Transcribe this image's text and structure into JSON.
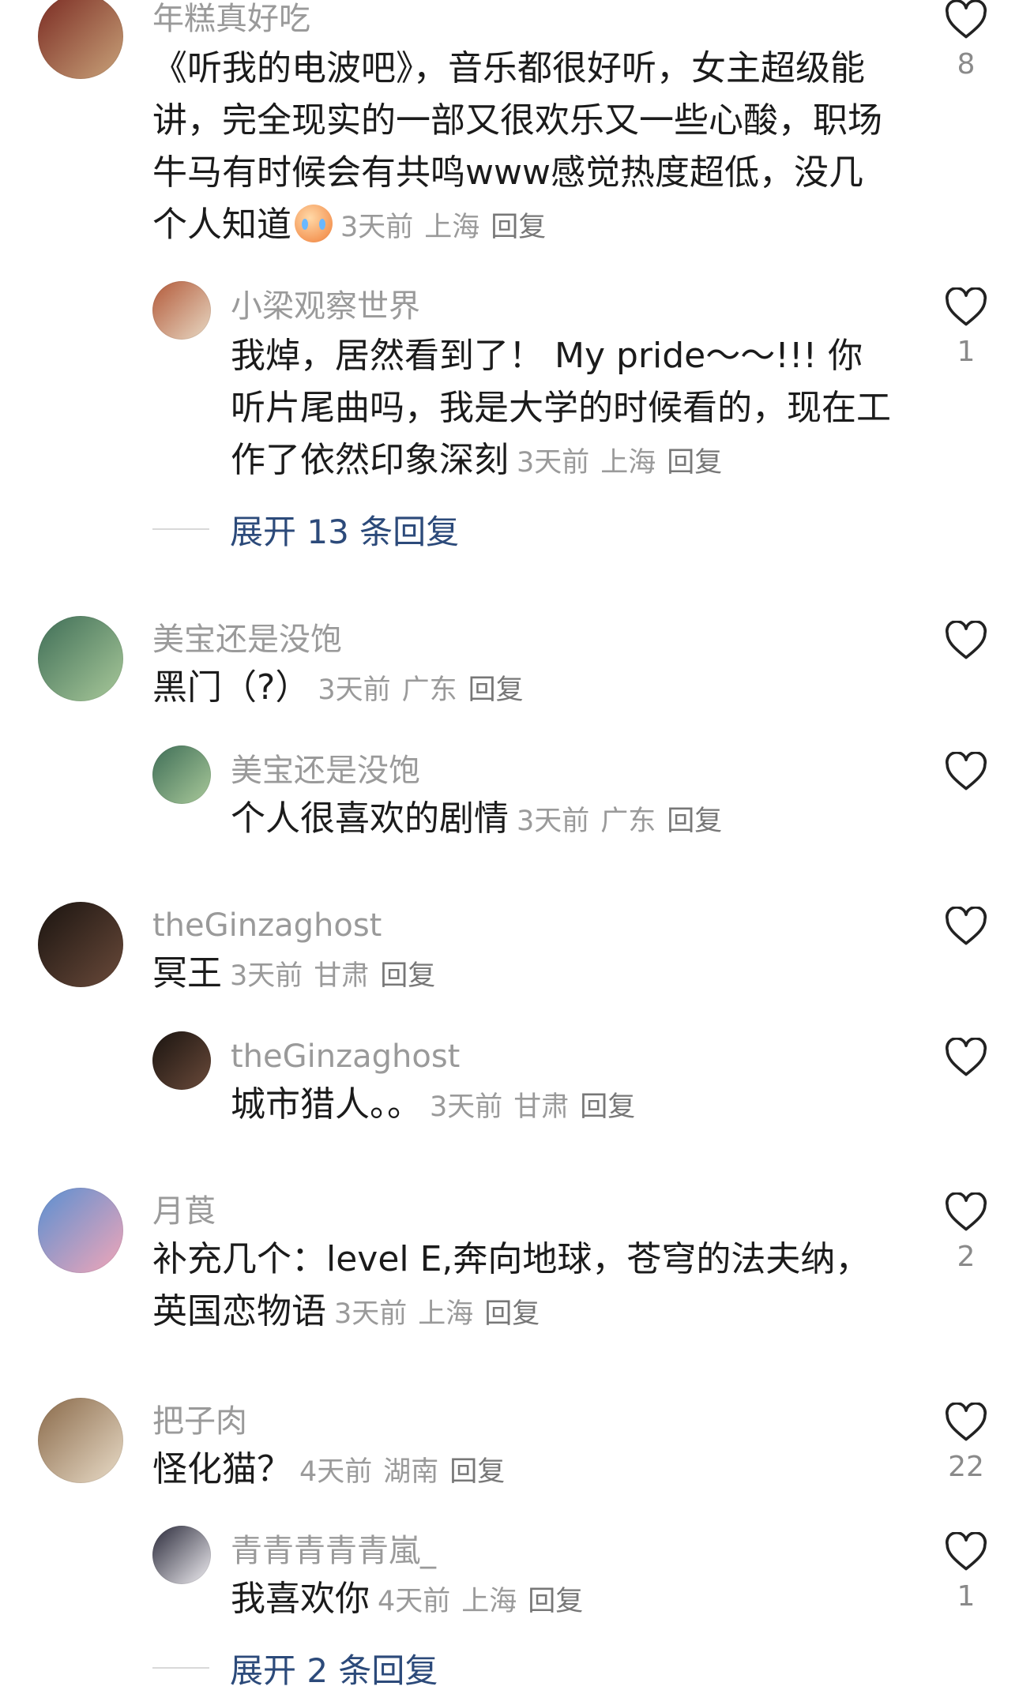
{
  "comments": [
    {
      "user": "年糕真好吃",
      "text": "《听我的电波吧》，音乐都很好听，女主超级能讲，完全现实的一部又很欢乐又一些心酸，职场牛马有时候会有共鸣www感觉热度超低，没几个人知道",
      "time": "3天前",
      "location": "上海",
      "reply": "回复",
      "likes": "8",
      "avatar_colors": [
        "#7a2a22",
        "#c9a37a"
      ]
    },
    {
      "user": "小梁观察世界",
      "text": "我焯，居然看到了！ My pride～～!!! 你听片尾曲吗，我是大学的时候看的，现在工作了依然印象深刻",
      "time": "3天前",
      "location": "上海",
      "reply": "回复",
      "likes": "1",
      "avatar_colors": [
        "#b35a3a",
        "#e8d9c4"
      ]
    },
    {
      "user": "美宝还是没饱",
      "text": "黑门（?）",
      "time": "3天前",
      "location": "广东",
      "reply": "回复",
      "likes": "",
      "avatar_colors": [
        "#3f6e57",
        "#a9c99a"
      ]
    },
    {
      "user": "美宝还是没饱",
      "text": "个人很喜欢的剧情",
      "time": "3天前",
      "location": "广东",
      "reply": "回复",
      "likes": "",
      "avatar_colors": [
        "#3f6e57",
        "#a9c99a"
      ]
    },
    {
      "user": "theGinzaghost",
      "text": "冥王",
      "time": "3天前",
      "location": "甘肃",
      "reply": "回复",
      "likes": "",
      "avatar_colors": [
        "#1a1410",
        "#6a4a3a"
      ]
    },
    {
      "user": "theGinzaghost",
      "text": "城市猎人。。",
      "time": "3天前",
      "location": "甘肃",
      "reply": "回复",
      "likes": "",
      "avatar_colors": [
        "#1a1410",
        "#6a4a3a"
      ]
    },
    {
      "user": "月莨",
      "text": "补充几个：level E,奔向地球，苍穹的法夫纳，英国恋物语",
      "time": "3天前",
      "location": "上海",
      "reply": "回复",
      "likes": "2",
      "avatar_colors": [
        "#5a8fd1",
        "#f2a6b8"
      ]
    },
    {
      "user": "把子肉",
      "text": "怪化猫？",
      "time": "4天前",
      "location": "湖南",
      "reply": "回复",
      "likes": "22",
      "avatar_colors": [
        "#8a6a4a",
        "#e9dcc8"
      ]
    },
    {
      "user": "青青青青青嵐_",
      "text": "我喜欢你",
      "time": "4天前",
      "location": "上海",
      "reply": "回复",
      "likes": "1",
      "avatar_colors": [
        "#2a2a3a",
        "#f0eef2"
      ]
    }
  ],
  "expands": [
    {
      "label": "展开 13 条回复"
    },
    {
      "label": "展开 2 条回复"
    }
  ]
}
